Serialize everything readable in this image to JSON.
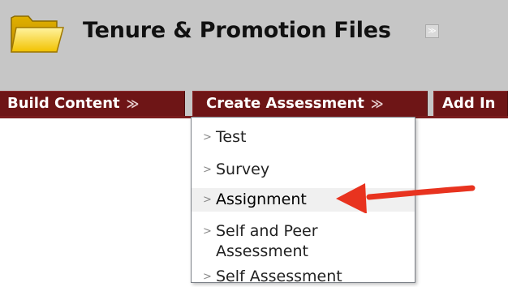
{
  "header": {
    "title": "Tenure & Promotion Files",
    "folder_icon": "folder-icon",
    "chevron_glyph": "≫",
    "bg_color": "#c6c6c6"
  },
  "toolbar": {
    "bg_color": "#c6c6c6",
    "button_color": "#6e1516",
    "buttons": [
      {
        "label": "Build Content",
        "chevron": "≫"
      },
      {
        "label": "Create Assessment",
        "chevron": "≫"
      },
      {
        "label": "Add In"
      }
    ]
  },
  "dropdown": {
    "items": [
      {
        "label": "Test"
      },
      {
        "label": "Survey"
      },
      {
        "label": "Assignment"
      },
      {
        "label": "Self and Peer",
        "label_line2": "Assessment"
      },
      {
        "label": "Self Assessment"
      }
    ],
    "bullet_glyph": ">"
  },
  "annotation": {
    "arrow_color": "#e8331f",
    "arrow_icon": "red-arrow-icon"
  }
}
